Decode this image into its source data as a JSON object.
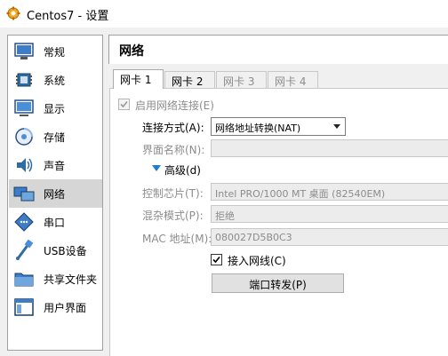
{
  "window": {
    "title": "Centos7 - 设置"
  },
  "sidebar": {
    "items": [
      {
        "label": "常规",
        "icon": "general-icon"
      },
      {
        "label": "系统",
        "icon": "system-icon"
      },
      {
        "label": "显示",
        "icon": "display-icon"
      },
      {
        "label": "存储",
        "icon": "storage-icon"
      },
      {
        "label": "声音",
        "icon": "audio-icon"
      },
      {
        "label": "网络",
        "icon": "network-icon",
        "selected": true
      },
      {
        "label": "串口",
        "icon": "serial-port-icon"
      },
      {
        "label": "USB设备",
        "icon": "usb-icon"
      },
      {
        "label": "共享文件夹",
        "icon": "shared-folder-icon"
      },
      {
        "label": "用户界面",
        "icon": "user-interface-icon"
      }
    ]
  },
  "main": {
    "title": "网络",
    "tabs": [
      {
        "label": "网卡 1",
        "active": true
      },
      {
        "label": "网卡 2",
        "active": false
      },
      {
        "label": "网卡 3",
        "active": false,
        "disabled": true
      },
      {
        "label": "网卡 4",
        "active": false,
        "disabled": true
      }
    ],
    "enable_adapter": {
      "label": "启用网络连接(E)",
      "checked": true
    },
    "attached_to": {
      "label": "连接方式(A):",
      "value": "网络地址转换(NAT)"
    },
    "name": {
      "label": "界面名称(N):",
      "value": ""
    },
    "advanced": {
      "label": "高级(d)"
    },
    "adapter_type": {
      "label": "控制芯片(T):",
      "value": "Intel PRO/1000 MT 桌面 (82540EM)"
    },
    "promiscuous": {
      "label": "混杂模式(P):",
      "value": "拒绝"
    },
    "mac": {
      "label": "MAC 地址(M):",
      "value": "080027D5B0C3"
    },
    "cable_connected": {
      "label": "接入网线(C)",
      "checked": true
    },
    "port_forwarding": {
      "label": "端口转发(P)"
    }
  },
  "colors": {
    "selected_bg": "#d6d6d6",
    "accent_blue": "#1e7cd6"
  }
}
